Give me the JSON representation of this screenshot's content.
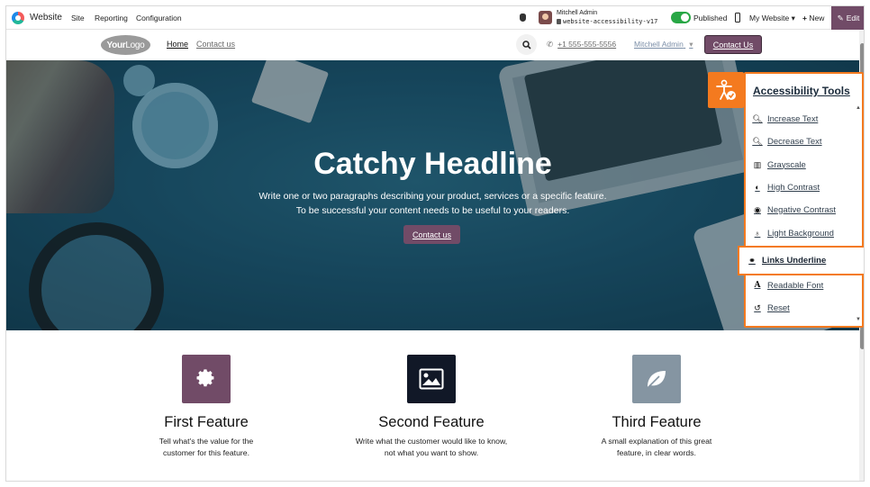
{
  "topbar": {
    "app_name": "Website",
    "menu": [
      "Site",
      "Reporting",
      "Configuration"
    ],
    "user_name": "Mitchell Admin",
    "database": "website-accessibility-v17",
    "published_label": "Published",
    "my_website_label": "My Website",
    "new_label": "New",
    "edit_label": "Edit"
  },
  "site_header": {
    "logo_bold": "Your",
    "logo_light": "Logo",
    "nav": [
      "Home",
      "Contact us"
    ],
    "phone": "+1 555-555-5556",
    "user_menu": "Mitchell Admin",
    "cta": "Contact Us"
  },
  "hero": {
    "title": "Catchy Headline",
    "subtitle_line1": "Write one or two paragraphs describing your product, services or a specific feature.",
    "subtitle_line2": "To be successful your content needs to be useful to your readers.",
    "button": "Contact us"
  },
  "features": [
    {
      "title": "First Feature",
      "line1": "Tell what's the value for the",
      "line2": "customer for this feature.",
      "icon": "gear-icon",
      "color": "#714b67"
    },
    {
      "title": "Second Feature",
      "line1": "Write what the customer would like to know,",
      "line2": "not what you want to show.",
      "icon": "picture-icon",
      "color": "#111827"
    },
    {
      "title": "Third Feature",
      "line1": "A small explanation of this great",
      "line2": "feature, in clear words.",
      "icon": "leaf-icon",
      "color": "#8595a2"
    }
  ],
  "accessibility": {
    "title": "Accessibility Tools",
    "items": [
      {
        "label": "Increase Text",
        "icon": "zoom-in-icon"
      },
      {
        "label": "Decrease Text",
        "icon": "zoom-out-icon"
      },
      {
        "label": "Grayscale",
        "icon": "bars-icon"
      },
      {
        "label": "High Contrast",
        "icon": "contrast-icon"
      },
      {
        "label": "Negative Contrast",
        "icon": "eye-icon"
      },
      {
        "label": "Light Background",
        "icon": "bulb-icon"
      },
      {
        "label": "Links Underline",
        "icon": "link-icon"
      },
      {
        "label": "Readable Font",
        "icon": "font-icon"
      },
      {
        "label": "Reset",
        "icon": "reset-icon"
      }
    ],
    "active_item": "Links Underline",
    "accent_color": "#f47a1f"
  }
}
